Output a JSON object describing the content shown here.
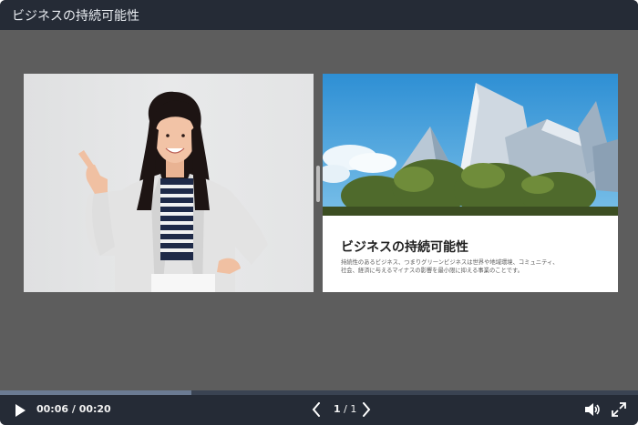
{
  "window": {
    "title": "ビジネスの持続可能性"
  },
  "slide": {
    "left_image": {
      "icon": "businesswoman-pointing-photo"
    },
    "right_card": {
      "image": {
        "icon": "modern-building-photo"
      },
      "title": "ビジネスの持続可能性",
      "description": "持続性のあるビジネス、つまりグリーンビジネスは世界や地域環境、コミュニティ、社会、経済に与えるマイナスの影響を最小限に抑える事業のことです。"
    }
  },
  "player": {
    "progress": 0.3,
    "time": "00:06 / 00:20",
    "page_current": "1",
    "page_separator": " / ",
    "page_total": "1",
    "icons": [
      "play-icon",
      "chevron-left-icon",
      "chevron-right-icon",
      "volume-icon",
      "fullscreen-icon"
    ],
    "colors": {
      "bar": "#252b36",
      "stage": "#5d5d5d",
      "progress": "#6b7b93"
    }
  }
}
